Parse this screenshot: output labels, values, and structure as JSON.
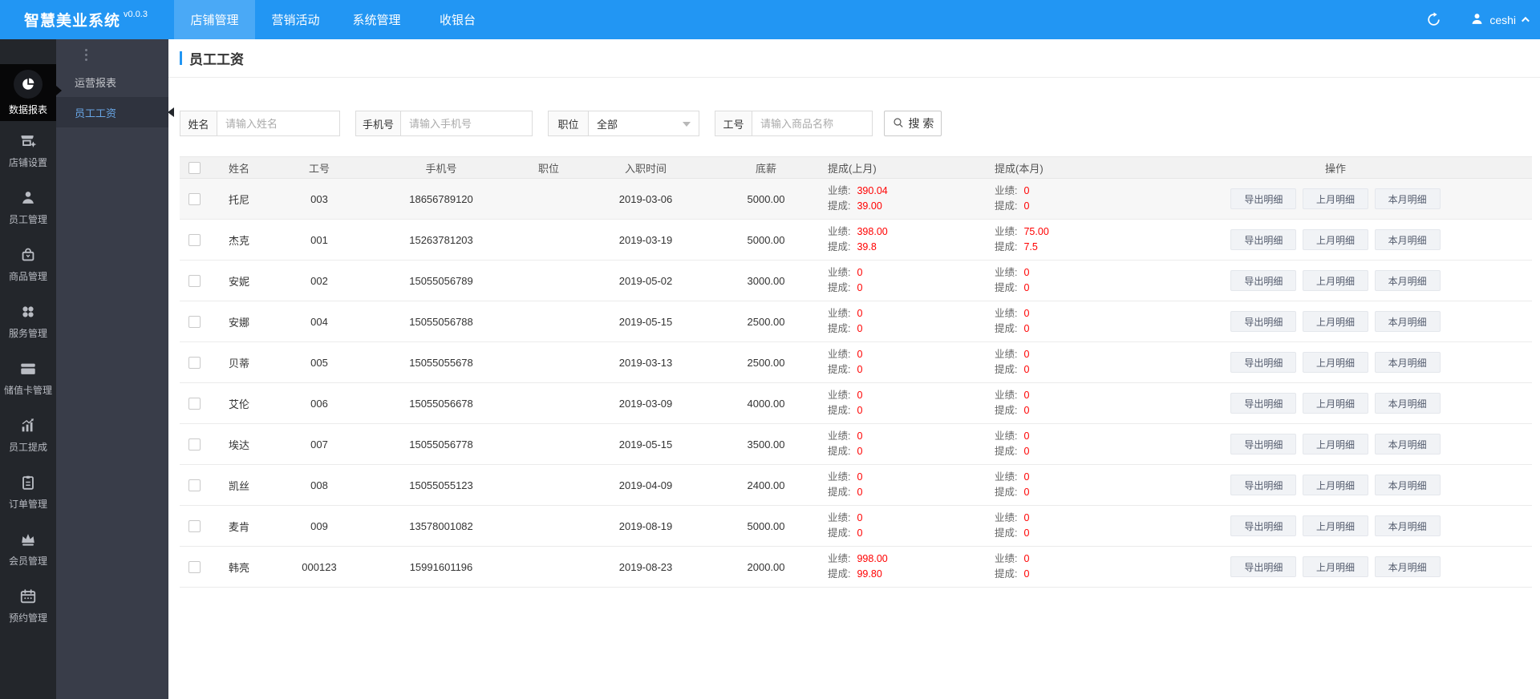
{
  "app": {
    "title": "智慧美业系统",
    "version": "v0.0.3"
  },
  "header": {
    "nav": [
      {
        "label": "店铺管理",
        "active": true
      },
      {
        "label": "营销活动",
        "active": false
      },
      {
        "label": "系统管理",
        "active": false
      },
      {
        "label": "收银台",
        "active": false
      }
    ],
    "user": {
      "name": "ceshi"
    }
  },
  "sidebar": {
    "items": [
      {
        "label": "数据报表",
        "icon": "pie-chart",
        "active": true
      },
      {
        "label": "店铺设置",
        "icon": "store-settings",
        "active": false
      },
      {
        "label": "员工管理",
        "icon": "staff-person",
        "active": false
      },
      {
        "label": "商品管理",
        "icon": "goods-bag",
        "active": false
      },
      {
        "label": "服务管理",
        "icon": "services-dots",
        "active": false
      },
      {
        "label": "储值卡管理",
        "icon": "stored-value-card",
        "active": false
      },
      {
        "label": "员工提成",
        "icon": "commission-chart",
        "active": false
      },
      {
        "label": "订单管理",
        "icon": "order-clipboard",
        "active": false
      },
      {
        "label": "会员管理",
        "icon": "member-crown",
        "active": false
      },
      {
        "label": "预约管理",
        "icon": "appointment-calendar",
        "active": false
      }
    ],
    "submenu": [
      {
        "label": "运营报表",
        "active": false
      },
      {
        "label": "员工工资",
        "active": true
      }
    ]
  },
  "page": {
    "title": "员工工资"
  },
  "filters": {
    "name": {
      "label": "姓名",
      "placeholder": "请输入姓名",
      "value": ""
    },
    "phone": {
      "label": "手机号",
      "placeholder": "请输入手机号",
      "value": ""
    },
    "position": {
      "label": "职位",
      "selected": "全部"
    },
    "emp_no": {
      "label": "工号",
      "placeholder": "请输入商品名称",
      "value": ""
    },
    "search_label": "搜 索"
  },
  "table": {
    "columns": [
      "姓名",
      "工号",
      "手机号",
      "职位",
      "入职时间",
      "底薪",
      "提成(上月)",
      "提成(本月)",
      "操作"
    ],
    "sub_labels": {
      "performance": "业绩:",
      "commission": "提成:"
    },
    "action_labels": [
      "导出明细",
      "上月明细",
      "本月明细"
    ],
    "rows": [
      {
        "striped": true,
        "name": "托尼",
        "emp_no": "003",
        "phone": "18656789120",
        "position": "",
        "hire_date": "2019-03-06",
        "base_salary": "5000.00",
        "last_month": {
          "performance": "390.04",
          "commission": "39.00"
        },
        "this_month": {
          "performance": "0",
          "commission": "0"
        }
      },
      {
        "striped": false,
        "name": "杰克",
        "emp_no": "001",
        "phone": "15263781203",
        "position": "",
        "hire_date": "2019-03-19",
        "base_salary": "5000.00",
        "last_month": {
          "performance": "398.00",
          "commission": "39.8"
        },
        "this_month": {
          "performance": "75.00",
          "commission": "7.5"
        }
      },
      {
        "striped": false,
        "name": "安妮",
        "emp_no": "002",
        "phone": "15055056789",
        "position": "",
        "hire_date": "2019-05-02",
        "base_salary": "3000.00",
        "last_month": {
          "performance": "0",
          "commission": "0"
        },
        "this_month": {
          "performance": "0",
          "commission": "0"
        }
      },
      {
        "striped": false,
        "name": "安娜",
        "emp_no": "004",
        "phone": "15055056788",
        "position": "",
        "hire_date": "2019-05-15",
        "base_salary": "2500.00",
        "last_month": {
          "performance": "0",
          "commission": "0"
        },
        "this_month": {
          "performance": "0",
          "commission": "0"
        }
      },
      {
        "striped": false,
        "name": "贝蒂",
        "emp_no": "005",
        "phone": "15055055678",
        "position": "",
        "hire_date": "2019-03-13",
        "base_salary": "2500.00",
        "last_month": {
          "performance": "0",
          "commission": "0"
        },
        "this_month": {
          "performance": "0",
          "commission": "0"
        }
      },
      {
        "striped": false,
        "name": "艾伦",
        "emp_no": "006",
        "phone": "15055056678",
        "position": "",
        "hire_date": "2019-03-09",
        "base_salary": "4000.00",
        "last_month": {
          "performance": "0",
          "commission": "0"
        },
        "this_month": {
          "performance": "0",
          "commission": "0"
        }
      },
      {
        "striped": false,
        "name": "埃达",
        "emp_no": "007",
        "phone": "15055056778",
        "position": "",
        "hire_date": "2019-05-15",
        "base_salary": "3500.00",
        "last_month": {
          "performance": "0",
          "commission": "0"
        },
        "this_month": {
          "performance": "0",
          "commission": "0"
        }
      },
      {
        "striped": false,
        "name": "凯丝",
        "emp_no": "008",
        "phone": "15055055123",
        "position": "",
        "hire_date": "2019-04-09",
        "base_salary": "2400.00",
        "last_month": {
          "performance": "0",
          "commission": "0"
        },
        "this_month": {
          "performance": "0",
          "commission": "0"
        }
      },
      {
        "striped": false,
        "name": "麦肯",
        "emp_no": "009",
        "phone": "13578001082",
        "position": "",
        "hire_date": "2019-08-19",
        "base_salary": "5000.00",
        "last_month": {
          "performance": "0",
          "commission": "0"
        },
        "this_month": {
          "performance": "0",
          "commission": "0"
        }
      },
      {
        "striped": false,
        "name": "韩亮",
        "emp_no": "000123",
        "phone": "15991601196",
        "position": "",
        "hire_date": "2019-08-23",
        "base_salary": "2000.00",
        "last_month": {
          "performance": "998.00",
          "commission": "99.80"
        },
        "this_month": {
          "performance": "0",
          "commission": "0"
        }
      }
    ]
  },
  "colors": {
    "topbar_blue": "#2296f3",
    "active_tab_blue": "#4aa9f6",
    "accent_blue": "#2296f3",
    "sidebar_dark": "#23262b",
    "submenu_dark": "#393d49",
    "selected_menu_text": "#68a5e4",
    "value_red": "#ff0000"
  }
}
